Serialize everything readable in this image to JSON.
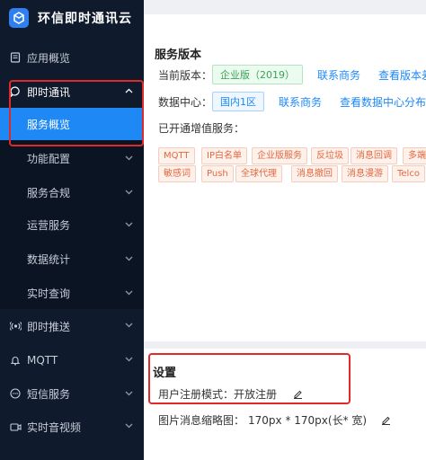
{
  "app": {
    "title": "环信即时通讯云"
  },
  "sidebar": {
    "items": [
      {
        "label": "应用概览",
        "icon": "doc-icon"
      },
      {
        "label": "即时通讯",
        "icon": "chat-icon"
      },
      {
        "label": "服务概览"
      },
      {
        "label": "功能配置"
      },
      {
        "label": "服务合规"
      },
      {
        "label": "运营服务"
      },
      {
        "label": "数据统计"
      },
      {
        "label": "实时查询"
      },
      {
        "label": "即时推送",
        "icon": "broadcast-icon"
      },
      {
        "label": "MQTT",
        "icon": "bell-icon"
      },
      {
        "label": "短信服务",
        "icon": "message-icon"
      },
      {
        "label": "实时音视频",
        "icon": "video-icon"
      }
    ]
  },
  "service": {
    "title": "服务版本",
    "version_label": "当前版本：",
    "version_value": "企业版（2019）",
    "contact_link": "联系商务",
    "view_diff_link": "查看版本差异",
    "datacenter_label": "数据中心：",
    "datacenter_value": "国内1区",
    "contact_link2": "联系商务",
    "view_dc_link": "查看数据中心分布",
    "enabled_label": "已开通增值服务：",
    "tags_row1": [
      "MQTT",
      "IP白名单",
      "企业版服务",
      "反垃圾",
      "消息回调",
      "多端"
    ],
    "tags_row2": [
      "敏感词",
      "Push",
      "全球代理",
      "消息撤回",
      "消息漫游",
      "Telco"
    ]
  },
  "settings": {
    "title": "设置",
    "register_label": "用户注册模式：",
    "register_value": "开放注册",
    "thumb_label": "图片消息缩略图：",
    "thumb_value": "170px * 170px(长* 宽)"
  },
  "colors": {
    "accent": "#1e88f5",
    "sidebar_bg": "#0f1a2c",
    "highlight": "#e02a2a"
  }
}
